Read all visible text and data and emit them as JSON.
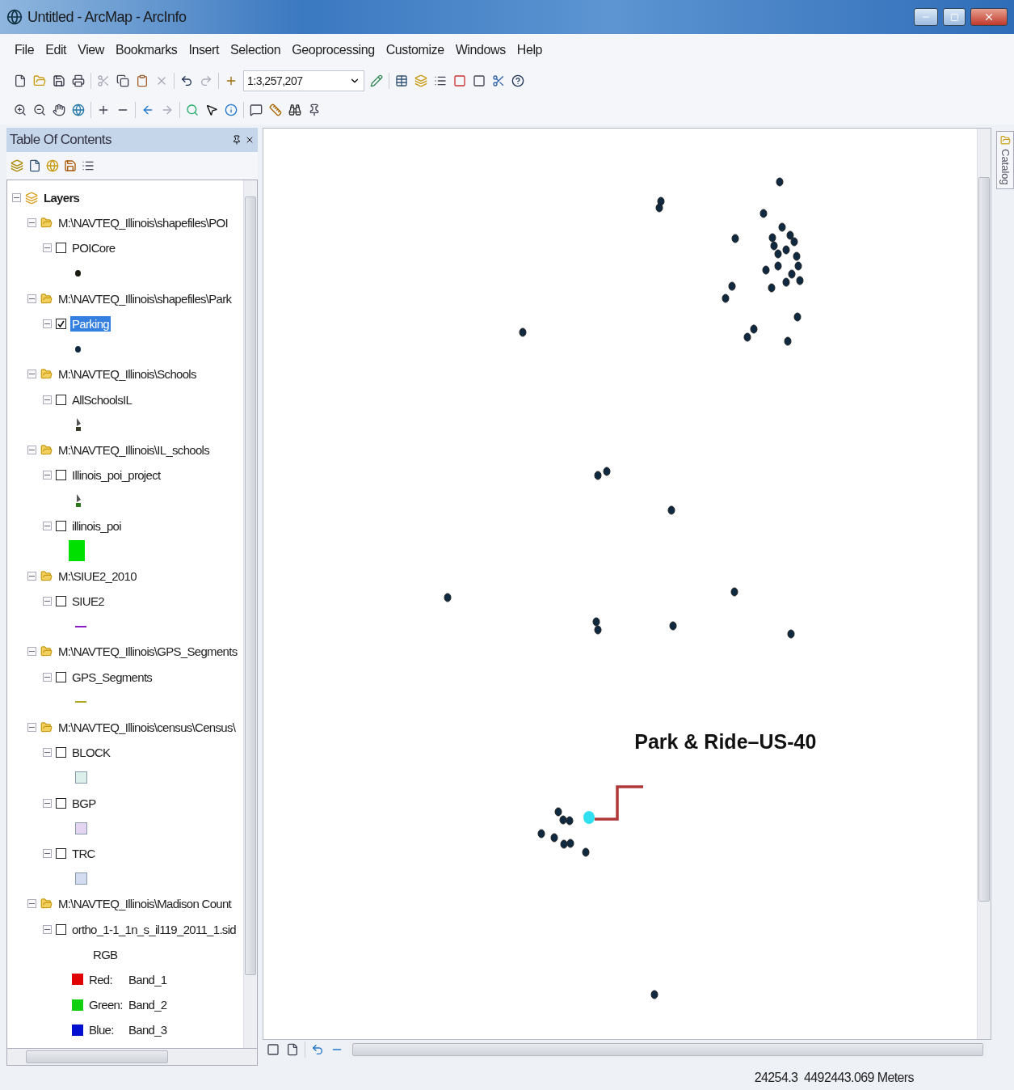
{
  "window": {
    "title": "Untitled - ArcMap - ArcInfo"
  },
  "menu": [
    "File",
    "Edit",
    "View",
    "Bookmarks",
    "Insert",
    "Selection",
    "Geoprocessing",
    "Customize",
    "Windows",
    "Help"
  ],
  "scale": {
    "value": "1:3,257,207"
  },
  "toc": {
    "title": "Table Of Contents",
    "tree": {
      "label": "Layers",
      "expanded": true,
      "children": [
        {
          "label": "M:\\NAVTEQ_Illinois\\shapefiles\\POI",
          "expanded": true,
          "children": [
            {
              "label": "POICore",
              "expanded": true,
              "checked": false,
              "selected": false,
              "legend": [
                {
                  "kind": "point",
                  "color": "#1a1a10"
                }
              ]
            }
          ]
        },
        {
          "label": "M:\\NAVTEQ_Illinois\\shapefiles\\Park",
          "expanded": true,
          "children": [
            {
              "label": "Parking",
              "expanded": true,
              "checked": true,
              "selected": true,
              "legend": [
                {
                  "kind": "point",
                  "color": "#0f2a40"
                }
              ]
            }
          ]
        },
        {
          "label": "M:\\NAVTEQ_Illinois\\Schools",
          "expanded": true,
          "children": [
            {
              "label": "AllSchoolsIL",
              "expanded": true,
              "checked": false,
              "selected": false,
              "legend": [
                {
                  "kind": "flag",
                  "color": "#3a3a2a"
                }
              ]
            }
          ]
        },
        {
          "label": "M:\\NAVTEQ_Illinois\\IL_schools",
          "expanded": true,
          "children": [
            {
              "label": "Illinois_poi_project",
              "expanded": true,
              "checked": false,
              "selected": false,
              "legend": [
                {
                  "kind": "flag",
                  "color": "#2c7a1c"
                }
              ]
            },
            {
              "label": "illinois_poi",
              "expanded": true,
              "checked": false,
              "selected": false,
              "legend": [
                {
                  "kind": "fill",
                  "color": "#00e000"
                }
              ]
            }
          ]
        },
        {
          "label": "M:\\SIUE2_2010",
          "expanded": true,
          "children": [
            {
              "label": "SIUE2",
              "expanded": true,
              "checked": false,
              "selected": false,
              "legend": [
                {
                  "kind": "line",
                  "color": "#8a1ac8"
                }
              ]
            }
          ]
        },
        {
          "label": "M:\\NAVTEQ_Illinois\\GPS_Segments",
          "expanded": true,
          "children": [
            {
              "label": "GPS_Segments",
              "expanded": true,
              "checked": false,
              "selected": false,
              "legend": [
                {
                  "kind": "line",
                  "color": "#b0a820"
                }
              ]
            }
          ]
        },
        {
          "label": "M:\\NAVTEQ_Illinois\\census\\Census\\",
          "expanded": true,
          "children": [
            {
              "label": "BLOCK",
              "expanded": true,
              "checked": false,
              "selected": false,
              "legend": [
                {
                  "kind": "outline",
                  "color": "#dcefea"
                }
              ]
            },
            {
              "label": "BGP",
              "expanded": true,
              "checked": false,
              "selected": false,
              "legend": [
                {
                  "kind": "outline",
                  "color": "#e4d6f2"
                }
              ]
            },
            {
              "label": "TRC",
              "expanded": true,
              "checked": false,
              "selected": false,
              "legend": [
                {
                  "kind": "outline",
                  "color": "#d4dcf2"
                }
              ]
            }
          ]
        },
        {
          "label": "M:\\NAVTEQ_Illinois\\Madison Count",
          "expanded": true,
          "children": [
            {
              "label": "ortho_1-1_1n_s_il119_2011_1.sid",
              "expanded": true,
              "checked": false,
              "selected": false,
              "legend": [
                {
                  "kind": "heading",
                  "text": "RGB"
                },
                {
                  "kind": "band",
                  "color": "#e00000",
                  "label": "Red:",
                  "value": "Band_1"
                },
                {
                  "kind": "band",
                  "color": "#10d010",
                  "label": "Green:",
                  "value": "Band_2"
                },
                {
                  "kind": "band",
                  "color": "#0010d0",
                  "label": "Blue:",
                  "value": "Band_3"
                }
              ]
            }
          ]
        }
      ]
    }
  },
  "map": {
    "label": "Park & Ride–US-40"
  },
  "side_tab": {
    "label": "Catalog"
  },
  "status_bar": {
    "coordinates": "24254.3  4492443.069 Meters"
  }
}
